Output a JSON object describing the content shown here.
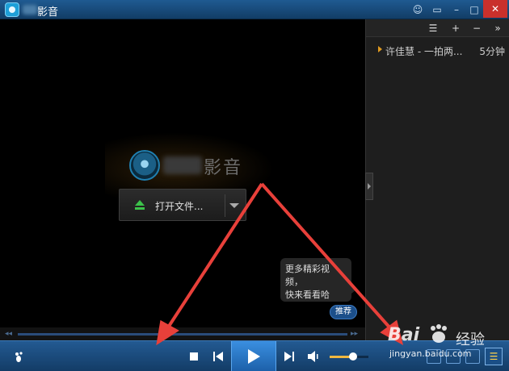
{
  "window": {
    "title": "影音",
    "buttons": {
      "skin": "☺",
      "mini": "▭",
      "minimize": "–",
      "maximize": "□",
      "close": "✕"
    }
  },
  "video": {
    "logo_text": "影音",
    "open_file_label": "打开文件...",
    "promo_text_line1": "更多精彩视频，",
    "promo_text_line2": "快来看看哈",
    "recommend_label": "推荐"
  },
  "playlist": {
    "toolbar": {
      "list": "☰",
      "add": "+",
      "remove": "−",
      "more": "»"
    },
    "items": [
      {
        "title": "许佳慧 - 一拍两...",
        "duration": "5分钟",
        "playing": true
      }
    ]
  },
  "seek": {
    "left_arrow": "◂◂",
    "right_arrow": "▸▸"
  },
  "controls": {
    "volume": 0.6
  },
  "watermark": {
    "brand": "Bai",
    "brand_suffix": "经验",
    "url": "jingyan.baidu.com"
  },
  "colors": {
    "accent": "#1f5a91",
    "playing_marker": "#e09a20",
    "annotation": "#e8403a"
  }
}
